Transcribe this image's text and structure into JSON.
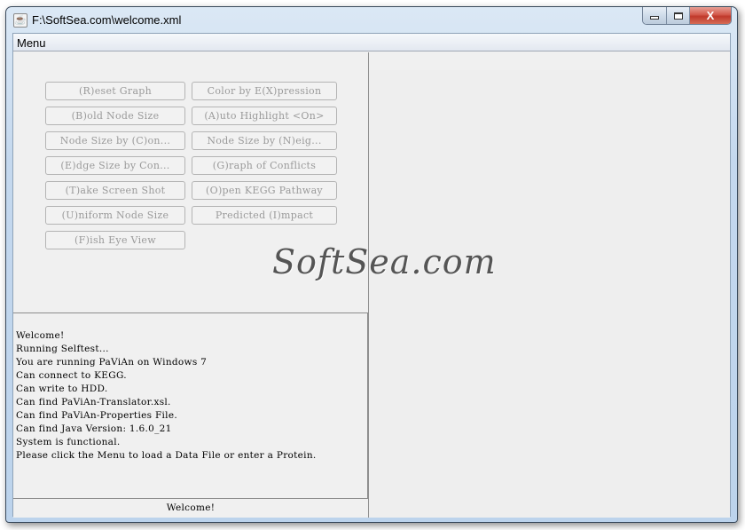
{
  "window": {
    "title": "F:\\SoftSea.com\\welcome.xml",
    "app_icon": "java-icon",
    "controls": {
      "minimize": "minimize-icon",
      "maximize": "maximize-icon",
      "close_label": "X"
    }
  },
  "menubar": {
    "items": [
      {
        "label": "Menu"
      }
    ]
  },
  "buttons": [
    {
      "label": "(R)eset Graph",
      "enabled": false
    },
    {
      "label": "Color by E(X)pression",
      "enabled": false
    },
    {
      "label": "(B)old Node Size",
      "enabled": false
    },
    {
      "label": "(A)uto Highlight <On>",
      "enabled": false
    },
    {
      "label": "Node Size by (C)on...",
      "enabled": false
    },
    {
      "label": "Node Size by (N)eig...",
      "enabled": false
    },
    {
      "label": "(E)dge Size by Con...",
      "enabled": false
    },
    {
      "label": "(G)raph of Conflicts",
      "enabled": false
    },
    {
      "label": "(T)ake Screen Shot",
      "enabled": false
    },
    {
      "label": "(O)pen KEGG Pathway",
      "enabled": false
    },
    {
      "label": "(U)niform Node Size",
      "enabled": false
    },
    {
      "label": "Predicted (I)mpact",
      "enabled": false
    },
    {
      "label": "(F)ish Eye View",
      "enabled": false
    }
  ],
  "log": {
    "lines": [
      "Welcome!",
      "Running Selftest...",
      "You are running PaViAn on Windows 7",
      "Can connect to KEGG.",
      "Can write to HDD.",
      "Can find PaViAn-Translator.xsl.",
      "Can find PaViAn-Properties File.",
      "Can find Java Version: 1.6.0_21",
      "System is functional.",
      "Please click the Menu to load a Data File or enter a Protein."
    ]
  },
  "status": {
    "text": "Welcome!"
  },
  "watermark": {
    "text": "SoftSea.com"
  }
}
